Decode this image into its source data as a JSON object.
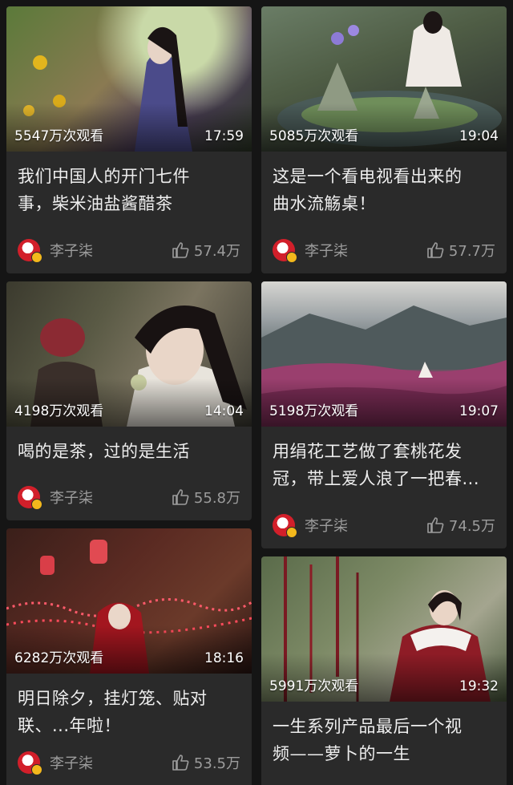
{
  "feed": {
    "videos": [
      {
        "views": "5547万次观看",
        "duration": "17:59",
        "title_lines": [
          "我们中国人的开门七件",
          "事，柴米油盐酱醋茶"
        ],
        "author": "李子柒",
        "likes": "57.4万"
      },
      {
        "views": "5085万次观看",
        "duration": "19:04",
        "title_lines": [
          "这是一个看电视看出来的",
          "曲水流觞桌！"
        ],
        "author": "李子柒",
        "likes": "57.7万"
      },
      {
        "views": "4198万次观看",
        "duration": "14:04",
        "title_lines": [
          "喝的是茶，过的是生活"
        ],
        "author": "李子柒",
        "likes": "55.8万"
      },
      {
        "views": "5198万次观看",
        "duration": "19:07",
        "title_lines": [
          "用绢花工艺做了套桃花发",
          "冠，带上爱人浪了一把春..."
        ],
        "author": "李子柒",
        "likes": "74.5万"
      },
      {
        "views": "6282万次观看",
        "duration": "18:16",
        "title_lines": [
          "明日除夕，挂灯笼、贴对",
          "联、...年啦！"
        ],
        "author": "李子柒",
        "likes": "53.5万"
      },
      {
        "views": "5991万次观看",
        "duration": "19:32",
        "title_lines": [
          "一生系列产品最后一个视",
          "频——萝卜的一生"
        ],
        "author": "",
        "likes": ""
      }
    ],
    "icons": {
      "like": "thumbs-up-icon",
      "avatar": "avatar",
      "verified": "verified-badge-icon"
    },
    "colors": {
      "background": "#151515",
      "card": "#2a2a2a",
      "title_text": "#eeeeee",
      "meta_text": "#9c9c9c",
      "avatar_red": "#d21f2a",
      "badge_gold": "#f3b81c"
    }
  }
}
